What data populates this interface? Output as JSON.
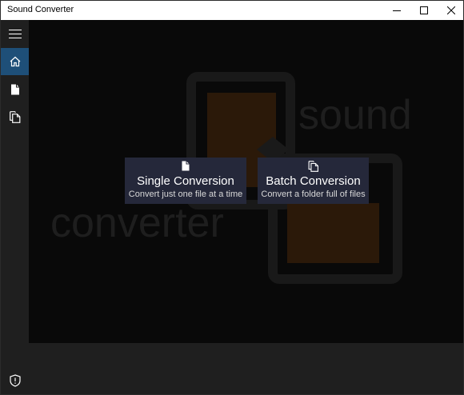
{
  "window": {
    "title": "Sound Converter"
  },
  "nav": {
    "items": [
      {
        "icon": "hamburger-menu-icon"
      },
      {
        "icon": "home-icon",
        "selected": true
      },
      {
        "icon": "single-file-icon"
      },
      {
        "icon": "multiple-files-icon"
      },
      {
        "icon": "shield-icon"
      }
    ]
  },
  "logo": {
    "word_top": "sound",
    "word_bottom": "converter"
  },
  "cards": {
    "single": {
      "title": "Single Conversion",
      "subtitle": "Convert just one file at a time"
    },
    "batch": {
      "title": "Batch Conversion",
      "subtitle": "Convert a folder full of files"
    }
  },
  "colors": {
    "nav_selected": "#1e4f78",
    "card_bg": "#25283a",
    "logo_orange": "#2e1a0a"
  }
}
